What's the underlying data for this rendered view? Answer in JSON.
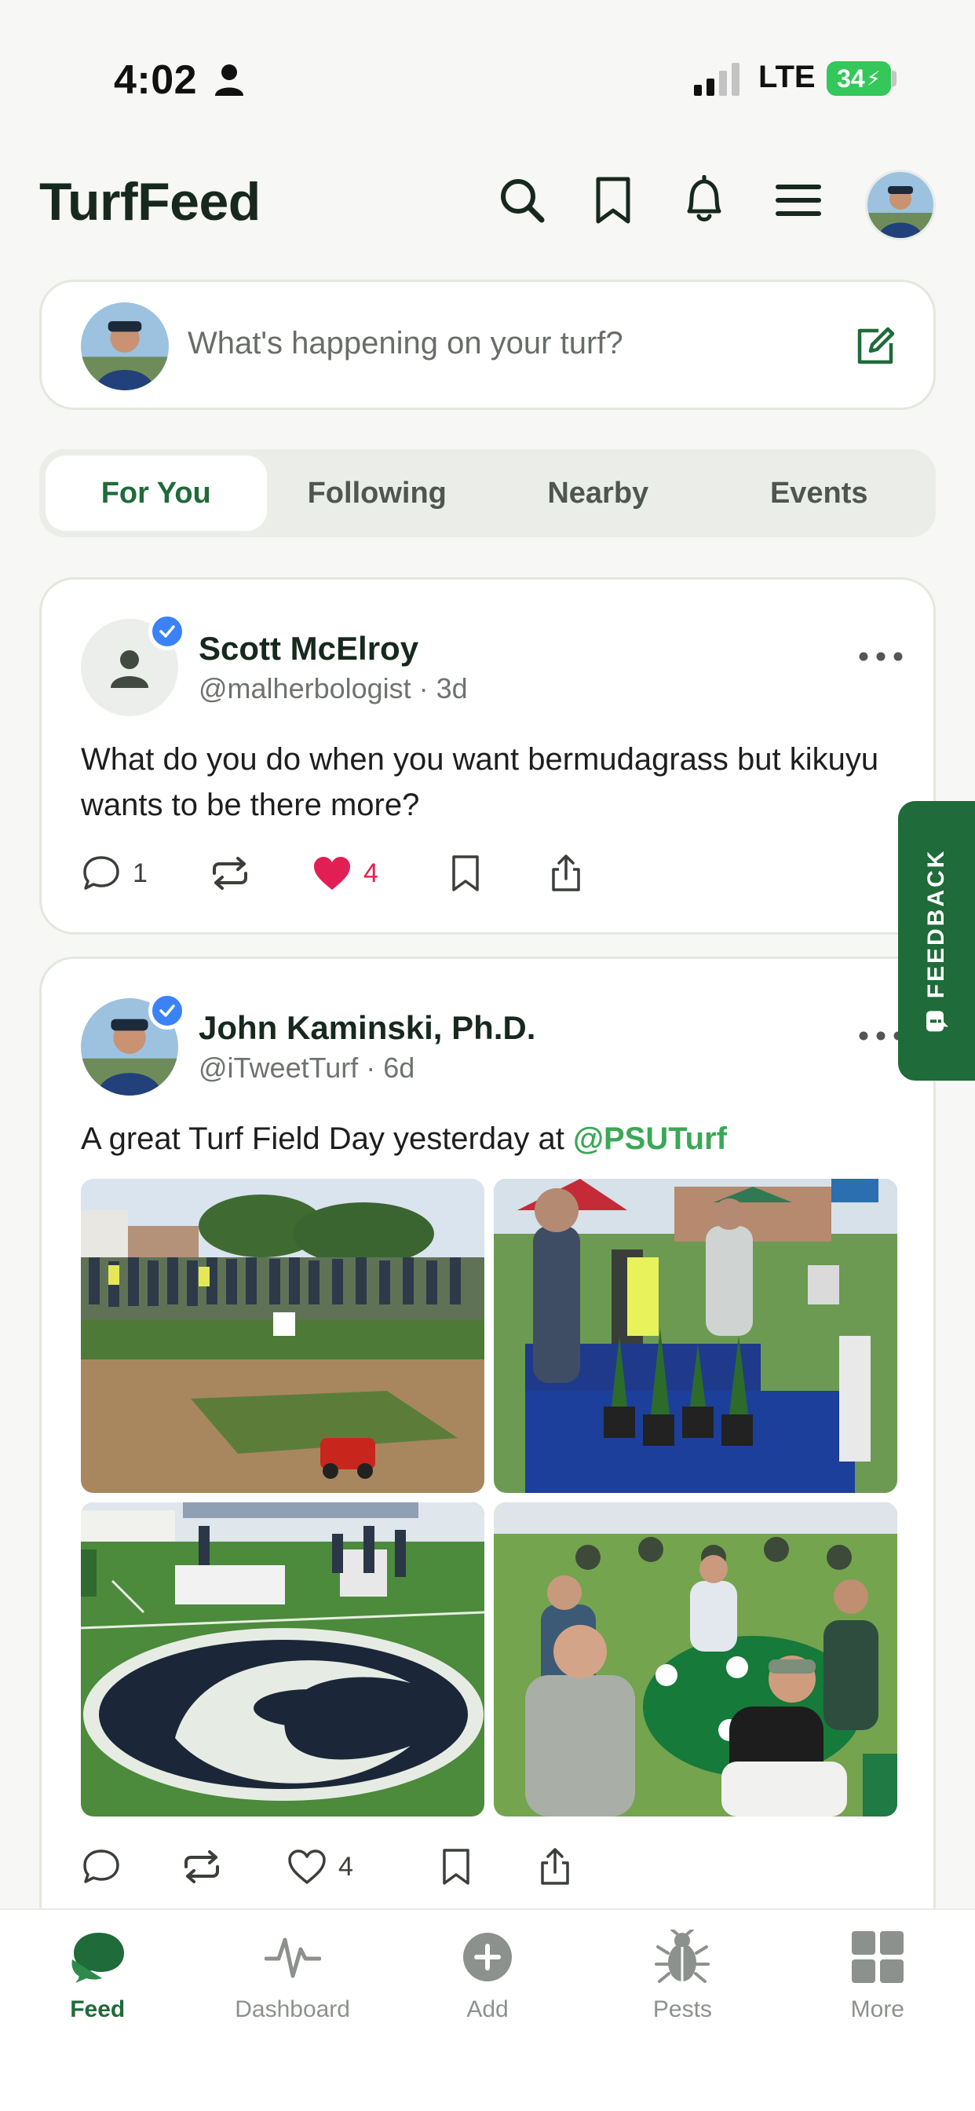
{
  "status_bar": {
    "time": "4:02",
    "network": "LTE",
    "battery": "34"
  },
  "header": {
    "title": "TurfFeed"
  },
  "composer": {
    "placeholder": "What's happening on your turf?"
  },
  "tabs": [
    {
      "label": "For You",
      "active": true
    },
    {
      "label": "Following",
      "active": false
    },
    {
      "label": "Nearby",
      "active": false
    },
    {
      "label": "Events",
      "active": false
    }
  ],
  "posts": [
    {
      "name": "Scott McElroy",
      "meta": "@malherbologist · 3d",
      "body": "What do you do when you want bermudagrass but kikuyu wants to be there more?",
      "comments": "1",
      "likes": "4",
      "liked": true
    },
    {
      "name": "John Kaminski, Ph.D.",
      "meta": "@iTweetTurf · 6d",
      "body": "A great Turf Field Day yesterday at ",
      "mention": "@PSUTurf",
      "likes": "4",
      "liked": false
    }
  ],
  "feedback": {
    "label": "FEEDBACK"
  },
  "bottom_nav": [
    {
      "label": "Feed",
      "icon": "feed-icon",
      "active": true
    },
    {
      "label": "Dashboard",
      "icon": "pulse-icon",
      "active": false
    },
    {
      "label": "Add",
      "icon": "add-icon",
      "active": false
    },
    {
      "label": "Pests",
      "icon": "bug-icon",
      "active": false
    },
    {
      "label": "More",
      "icon": "grid-icon",
      "active": false
    }
  ],
  "colors": {
    "brand_green": "#1f6b39",
    "mention_green": "#3aa857",
    "like_red": "#e21f55",
    "verified_blue": "#3b82f6"
  }
}
